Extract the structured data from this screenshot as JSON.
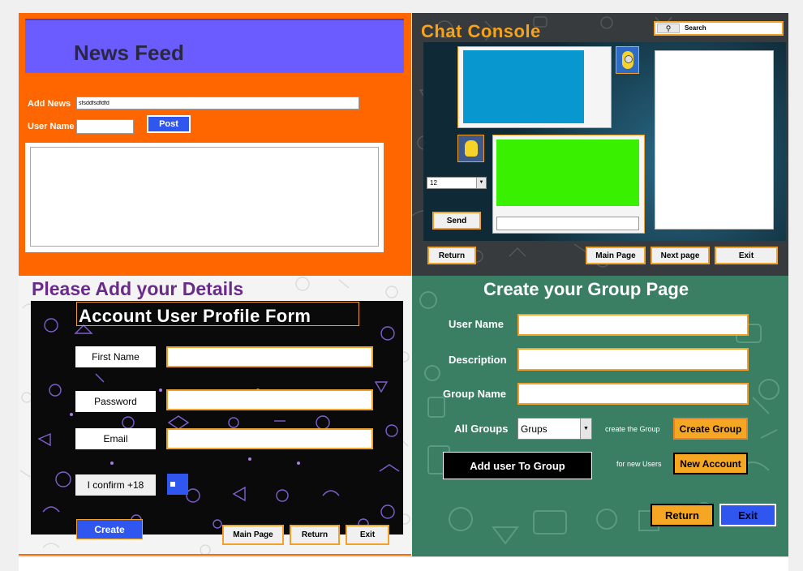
{
  "news_feed": {
    "title": "News Feed",
    "add_news_label": "Add News",
    "add_news_value": "sfsddfsdfdfd",
    "user_name_label": "User Name",
    "user_name_value": "",
    "post_button": "Post"
  },
  "chat_console": {
    "title": "Chat Console",
    "search_label": "Search",
    "number_select_value": "12",
    "send_button": "Send",
    "return_button": "Return",
    "main_page_button": "Main Page",
    "next_page_button": "Next page",
    "exit_button": "Exit"
  },
  "details_form": {
    "heading": "Please Add your Details",
    "form_title": "Account User Profile Form",
    "first_name_label": "First Name",
    "password_label": "Password",
    "email_label": "Email",
    "confirm_label": "I confirm +18",
    "create_button": "Create",
    "main_page_button": "Main Page",
    "return_button": "Return",
    "exit_button": "Exit"
  },
  "group_page": {
    "title": "Create your Group Page",
    "user_name_label": "User Name",
    "description_label": "Description",
    "group_name_label": "Group Name",
    "all_groups_label": "All Groups",
    "groups_select_value": "Grups",
    "create_hint": "create the Group",
    "create_group_button": "Create Group",
    "add_user_button": "Add user To Group",
    "new_users_hint": "for new Users",
    "new_account_button": "New Account",
    "return_button": "Return",
    "exit_button": "Exit"
  },
  "colors": {
    "news_bg": "#ff6600",
    "news_header": "#6b5cff",
    "orange_border": "#f2a12a",
    "green_panel": "#3a7e63",
    "blue_button": "#2f57f0"
  }
}
